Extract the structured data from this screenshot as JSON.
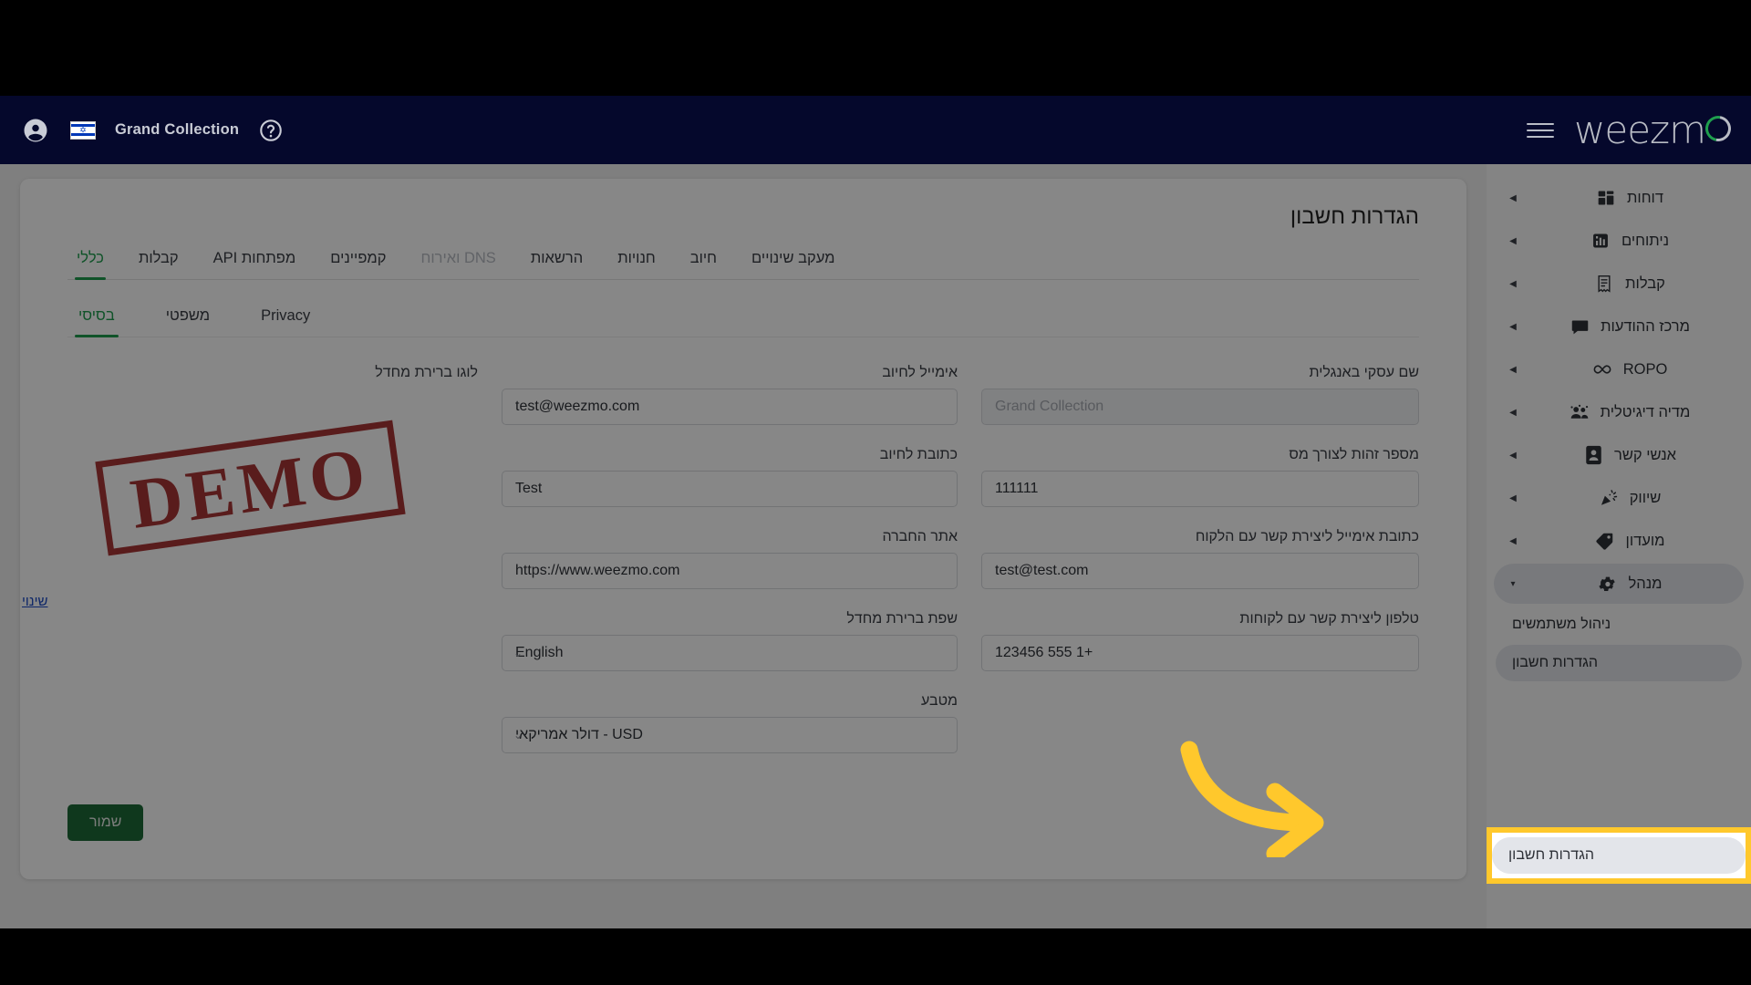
{
  "topbar": {
    "account_name": "Grand Collection",
    "profile_icon": "account-circle-icon",
    "flag_icon": "israel-flag-icon",
    "help_icon": "help-circle-icon",
    "menu_icon": "hamburger-menu-icon",
    "logo_text": "weezm",
    "brand_accent": "#1f9e4e"
  },
  "sidebar": {
    "items": [
      {
        "label": "דוחות",
        "icon": "dashboard-grid-icon",
        "caret": "◀"
      },
      {
        "label": "ניתוחים",
        "icon": "bar-chart-icon",
        "caret": "◀"
      },
      {
        "label": "קבלות",
        "icon": "receipt-icon",
        "caret": "◀"
      },
      {
        "label": "מרכז ההודעות",
        "icon": "message-bubble-icon",
        "caret": "◀"
      },
      {
        "label": "ROPO",
        "icon": "infinity-icon",
        "caret": "◀"
      },
      {
        "label": "מדיה דיגיטלית",
        "icon": "people-group-icon",
        "caret": "◀"
      },
      {
        "label": "אנשי קשר",
        "icon": "contact-card-icon",
        "caret": "◀"
      },
      {
        "label": "שיווק",
        "icon": "megaphone-confetti-icon",
        "caret": "◀"
      },
      {
        "label": "מועדון",
        "icon": "tag-icon",
        "caret": "◀"
      },
      {
        "label": "מנהל",
        "icon": "gear-icon",
        "caret": "▾"
      }
    ],
    "sub_items": [
      {
        "label": "ניהול משתמשים"
      },
      {
        "label": "הגדרות חשבון"
      }
    ]
  },
  "page": {
    "title": "הגדרות חשבון"
  },
  "tabs": [
    {
      "label": "כללי",
      "state": "active"
    },
    {
      "label": "קבלות",
      "state": "normal"
    },
    {
      "label": "מפתחות API",
      "state": "normal"
    },
    {
      "label": "קמפיינים",
      "state": "normal"
    },
    {
      "label": "DNS ואירוח",
      "state": "disabled"
    },
    {
      "label": "הרשאות",
      "state": "normal"
    },
    {
      "label": "חנויות",
      "state": "normal"
    },
    {
      "label": "חיוב",
      "state": "normal"
    },
    {
      "label": "מעקב שינויים",
      "state": "normal"
    }
  ],
  "subtabs": [
    {
      "label": "בסיסי",
      "state": "active"
    },
    {
      "label": "משפטי",
      "state": "normal"
    },
    {
      "label": "Privacy",
      "state": "normal"
    }
  ],
  "form": {
    "col_right": [
      {
        "label": "שם עסקי באנגלית",
        "value": "",
        "placeholder": "Grand Collection",
        "type": "text",
        "disabled": true
      },
      {
        "label": "מספר זהות לצורך מס",
        "value": "111111",
        "placeholder": "",
        "type": "text",
        "disabled": false
      },
      {
        "label": "כתובת אימייל ליצירת קשר עם הלקוח",
        "value": "test@test.com",
        "placeholder": "",
        "type": "text",
        "disabled": false
      },
      {
        "label": "טלפון ליצירת קשר עם לקוחות",
        "value": "+1 555 123456",
        "placeholder": "",
        "type": "text",
        "disabled": false
      }
    ],
    "col_mid": [
      {
        "label": "אימייל לחיוב",
        "value": "test@weezmo.com",
        "placeholder": "",
        "type": "text",
        "disabled": false
      },
      {
        "label": "כתובת לחיוב",
        "value": "Test",
        "placeholder": "",
        "type": "text",
        "disabled": false
      },
      {
        "label": "אתר החברה",
        "value": "https://www.weezmo.com",
        "placeholder": "",
        "type": "text",
        "disabled": false
      },
      {
        "label": "שפת ברירת מחדל",
        "value": "English",
        "placeholder": "",
        "type": "select",
        "disabled": false
      },
      {
        "label": "מטבע",
        "value": "USD - דולר אמריקאי",
        "placeholder": "",
        "type": "select",
        "disabled": false
      }
    ],
    "logo": {
      "label": "לוגו ברירת מחדל",
      "stamp_text": "DEMO",
      "change_link": "שינוי"
    },
    "save_label": "שמור"
  },
  "annotation": {
    "arrow_color": "#ffc82c",
    "highlight_color": "#ffc82c",
    "highlighted_item": "הגדרות חשבון"
  }
}
